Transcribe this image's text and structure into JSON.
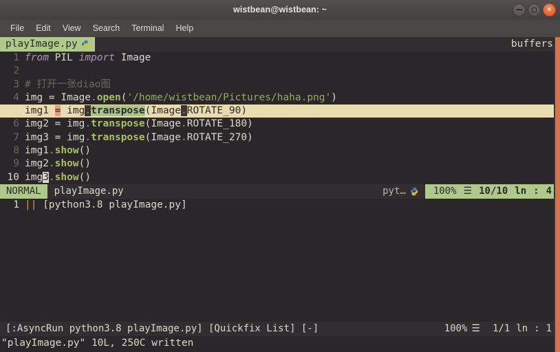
{
  "titlebar": {
    "title": "wistbean@wistbean: ~",
    "controls": [
      {
        "name": "minimize",
        "glyph": "–"
      },
      {
        "name": "maximize",
        "glyph": "□"
      },
      {
        "name": "close",
        "glyph": "×"
      }
    ]
  },
  "menubar": {
    "items": [
      "File",
      "Edit",
      "View",
      "Search",
      "Terminal",
      "Help"
    ]
  },
  "tabline": {
    "active_tab": "playImage.py",
    "tab_icon": "python-logo-icon",
    "right_label": "buffers"
  },
  "editor": {
    "lines": [
      {
        "num": "1",
        "text": "from PIL import Image"
      },
      {
        "num": "2",
        "text": ""
      },
      {
        "num": "3",
        "text": "# 打开一张diao图"
      },
      {
        "num": "4",
        "text": "img = Image.open('/home/wistbean/Pictures/haha.png')"
      },
      {
        "num": "5",
        "text": "img1 = img.transpose(Image.ROTATE_90)"
      },
      {
        "num": "6",
        "text": "img2 = img.transpose(Image.ROTATE_180)"
      },
      {
        "num": "7",
        "text": "img3 = img.transpose(Image.ROTATE_270)"
      },
      {
        "num": "8",
        "text": "img1.show()"
      },
      {
        "num": "9",
        "text": "img2.show()"
      },
      {
        "num": "10",
        "text": "img3.show()"
      }
    ],
    "tokens": {
      "l1_from": "from",
      "l1_pil": " PIL ",
      "l1_import": "import",
      "l1_image": " Image",
      "l3_comment": "# 打开一张diao图",
      "l4_img": "img = Image",
      "l4_dot": ".",
      "l4_open": "open",
      "l4_lparen": "(",
      "l4_str": "'/home/wistbean/Pictures/haha.png'",
      "l4_rparen": ")",
      "l5_a": "img1 ",
      "l5_eq": "=",
      "l5_b": " img",
      "l5_dot": ".",
      "l5_fn": "transpose",
      "l5_c": "(Image",
      "l5_dot2": ".",
      "l5_d": "ROTATE_90)",
      "l6_a": "img2 = img",
      "l6_dot": ".",
      "l6_fn": "transpose",
      "l6_b": "(Image",
      "l6_dot2": ".",
      "l6_c": "ROTATE_180)",
      "l7_a": "img3 = img",
      "l7_dot": ".",
      "l7_fn": "transpose",
      "l7_b": "(Image",
      "l7_dot2": ".",
      "l7_c": "ROTATE_270)",
      "l8_a": "img1",
      "l8_dot": ".",
      "l8_fn": "show",
      "l8_b": "()",
      "l9_a": "img2",
      "l9_dot": ".",
      "l9_fn": "show",
      "l9_b": "()",
      "l10_a": "img",
      "l10_cursor": "3",
      "l10_dot": ".",
      "l10_fn": "show",
      "l10_b": "()"
    }
  },
  "statusline": {
    "mode": "NORMAL",
    "filename": "playImage.py",
    "filetype": "pyt…",
    "filetype_icon": "python-logo-icon",
    "percent": "100%",
    "percent_icon": "☰",
    "position": "10/10",
    "line_label": "ln",
    "colon": ":",
    "column": "4"
  },
  "quickfix": {
    "line_number": "1",
    "bars": "||",
    "text": "[python3.8 playImage.py]"
  },
  "bottom_status": {
    "command": "[:AsyncRun python3.8 playImage.py] [Quickfix List] [-]",
    "percent": "100%",
    "percent_icon": "☰",
    "position": "1/1",
    "line_label": "ln",
    "colon": ":",
    "column": "1"
  },
  "message": {
    "text": "\"playImage.py\" 10L, 250C written"
  },
  "colors": {
    "background": "#2b2629",
    "accent_green": "#afc98c",
    "cursorline": "#e8dcb0",
    "search_op": "#e89b7e",
    "scrollbar": "#d9714a",
    "titlebar": "#4b4745",
    "close_button": "#e2551f"
  }
}
